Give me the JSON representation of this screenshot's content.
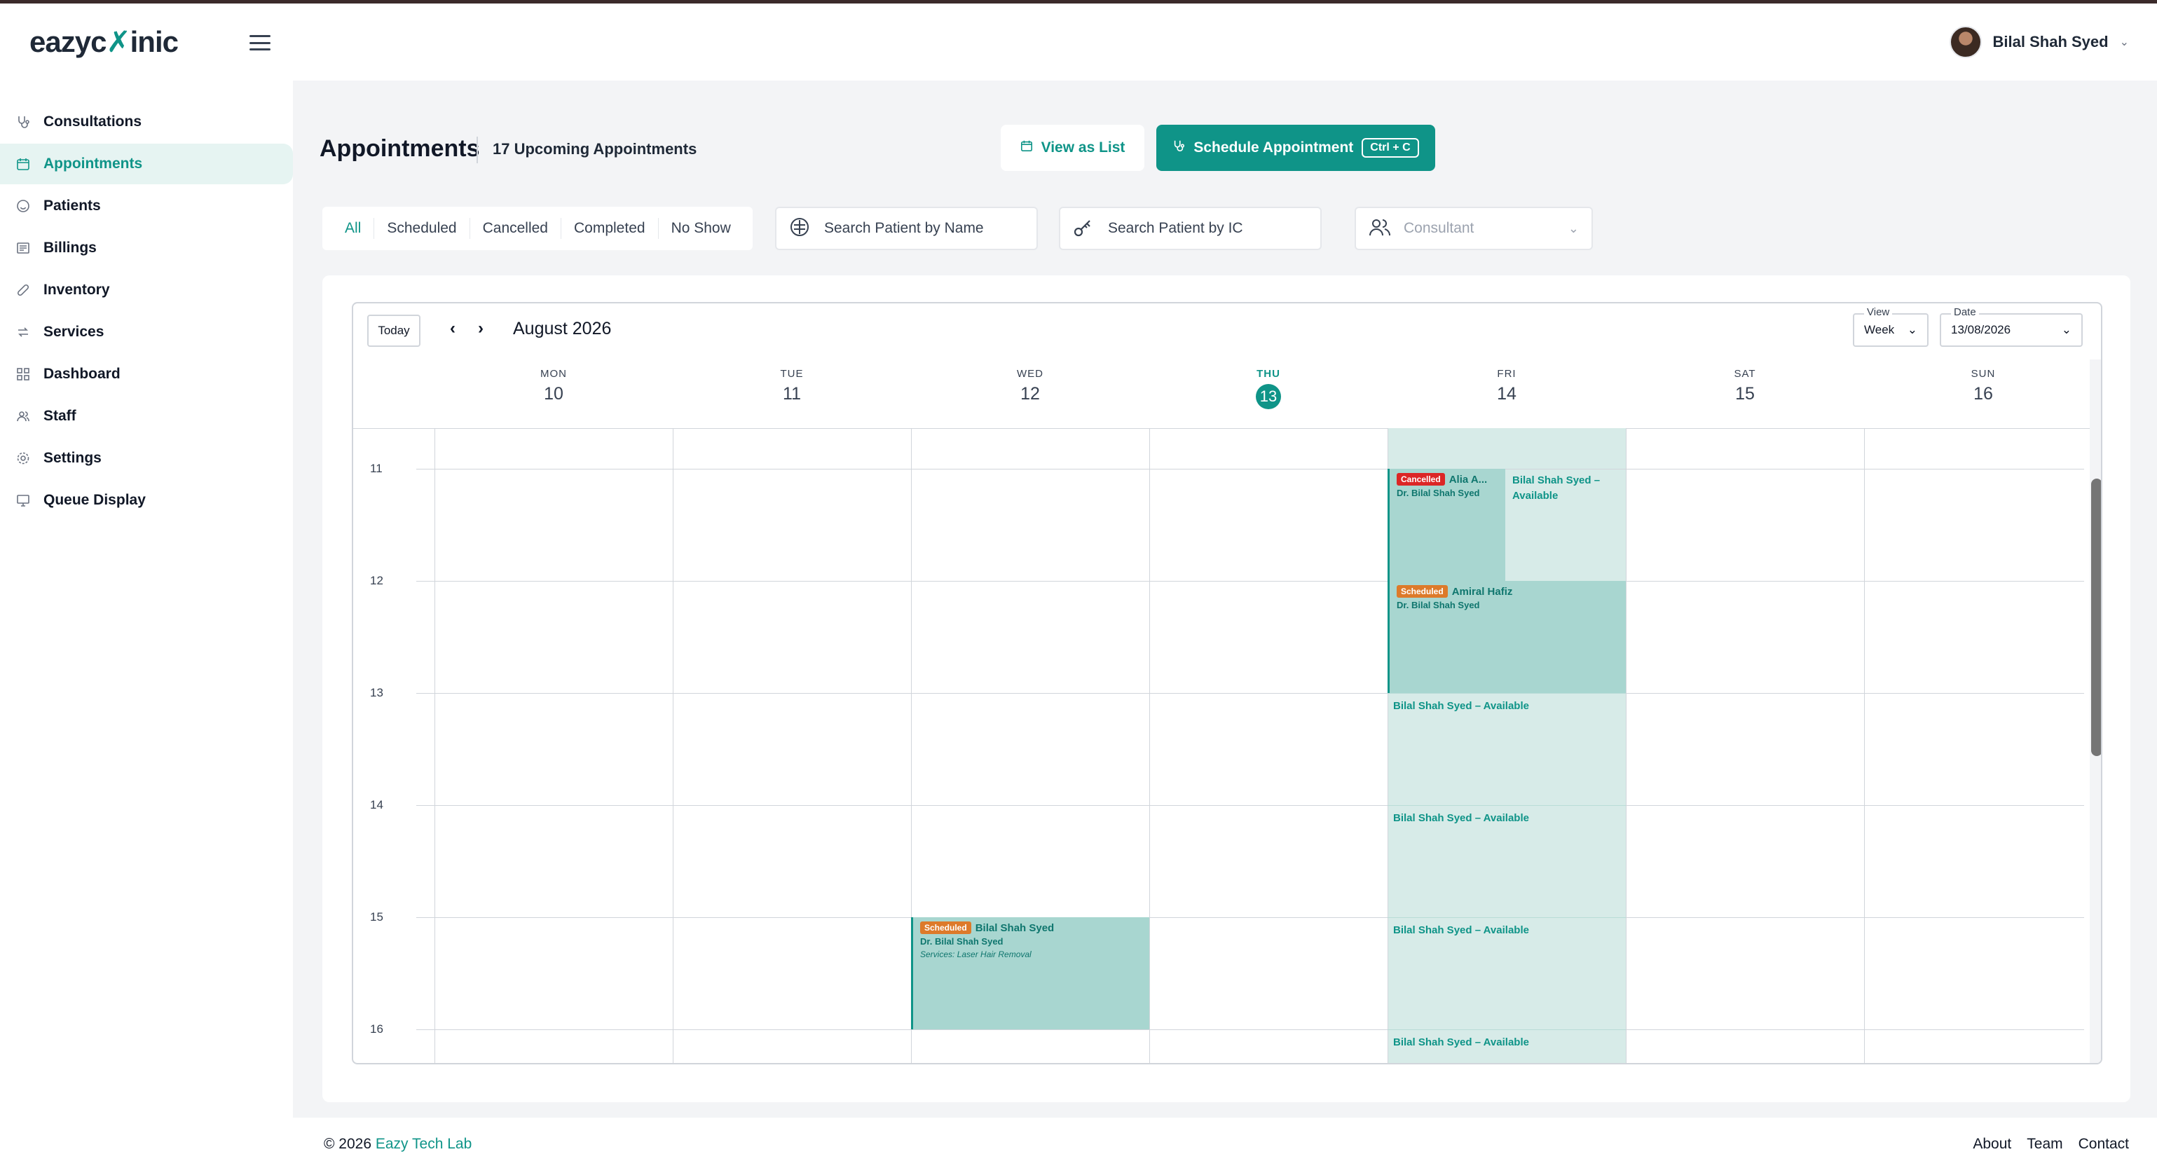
{
  "header": {
    "logo_left": "eazyc",
    "logo_mark": "✗",
    "logo_right": "inic",
    "user_name": "Bilal Shah Syed"
  },
  "sidebar": {
    "items": [
      {
        "label": "Consultations",
        "icon": "stethoscope-icon"
      },
      {
        "label": "Appointments",
        "icon": "calendar-icon",
        "active": true
      },
      {
        "label": "Patients",
        "icon": "smile-icon"
      },
      {
        "label": "Billings",
        "icon": "receipt-icon"
      },
      {
        "label": "Inventory",
        "icon": "pill-icon"
      },
      {
        "label": "Services",
        "icon": "swap-icon"
      },
      {
        "label": "Dashboard",
        "icon": "grid-icon"
      },
      {
        "label": "Staff",
        "icon": "users-icon"
      },
      {
        "label": "Settings",
        "icon": "gear-icon"
      },
      {
        "label": "Queue Display",
        "icon": "monitor-icon"
      }
    ]
  },
  "main": {
    "title": "Appointments",
    "upcoming": "17 Upcoming Appointments",
    "view_as_list": "View as List",
    "schedule_button": "Schedule Appointment",
    "schedule_shortcut": "Ctrl + C",
    "filter_tabs": [
      "All",
      "Scheduled",
      "Cancelled",
      "Completed",
      "No Show"
    ],
    "search_name_placeholder": "Search Patient by Name",
    "search_ic_placeholder": "Search Patient by IC",
    "consultant_placeholder": "Consultant"
  },
  "calendar": {
    "today_label": "Today",
    "prev": "‹",
    "next": "›",
    "month": "August 2026",
    "view_label": "View",
    "view_value": "Week",
    "date_label": "Date",
    "date_value": "13/08/2026",
    "days": [
      {
        "name": "MON",
        "date": "10"
      },
      {
        "name": "TUE",
        "date": "11"
      },
      {
        "name": "WED",
        "date": "12"
      },
      {
        "name": "THU",
        "date": "13",
        "today": true
      },
      {
        "name": "FRI",
        "date": "14"
      },
      {
        "name": "SAT",
        "date": "15"
      },
      {
        "name": "SUN",
        "date": "16"
      }
    ],
    "hours": [
      "11",
      "12",
      "13",
      "14",
      "15",
      "16"
    ],
    "events": {
      "cancelled": {
        "badge": "Cancelled",
        "patient": "Alia A...",
        "doctor": "Dr. Bilal Shah Syed"
      },
      "available_split": "Bilal Shah Syed – Available",
      "scheduled_fri": {
        "badge": "Scheduled",
        "patient": "Amiral Hafiz",
        "doctor": "Dr. Bilal Shah Syed"
      },
      "available_13": "Bilal Shah Syed – Available",
      "available_14": "Bilal Shah Syed – Available",
      "available_15": "Bilal Shah Syed – Available",
      "available_16": "Bilal Shah Syed – Available",
      "scheduled_wed": {
        "badge": "Scheduled",
        "patient": "Bilal Shah Syed",
        "doctor": "Dr. Bilal Shah Syed",
        "services": "Services: Laser Hair Removal"
      }
    }
  },
  "footer": {
    "copyright": "© 2026",
    "brand": "Eazy Tech Lab",
    "links": [
      "About",
      "Team",
      "Contact"
    ]
  },
  "colors": {
    "accent": "#0f9488",
    "event_bg": "#a8d6d0",
    "day_highlight": "#d7ebe8",
    "cancelled": "#dc2626",
    "scheduled": "#dd7a2a"
  }
}
